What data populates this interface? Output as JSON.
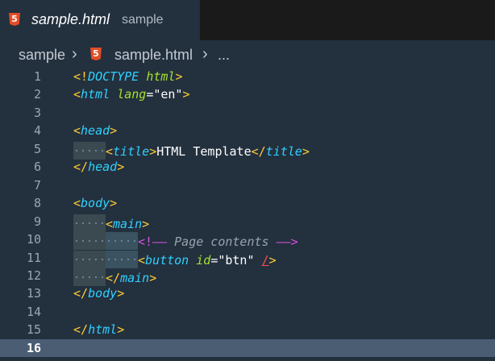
{
  "tab": {
    "title": "sample.html",
    "description": "sample",
    "icon": "html5-icon"
  },
  "breadcrumb": {
    "root": "sample",
    "separator": "›",
    "file": "sample.html",
    "more": "..."
  },
  "editor": {
    "current_line": 16,
    "lines": [
      {
        "n": "1",
        "html": "<span class=\"p\">&lt;!</span><span class=\"t\">DOCTYPE</span> <span class=\"a\">html</span><span class=\"p\">&gt;</span>"
      },
      {
        "n": "2",
        "html": "<span class=\"p\">&lt;</span><span class=\"t\">html</span> <span class=\"a\">lang</span><span class=\"e\">=</span><span class=\"s\">\"en\"</span><span class=\"p\">&gt;</span>"
      },
      {
        "n": "3",
        "html": ""
      },
      {
        "n": "4",
        "html": "<span class=\"p\">&lt;</span><span class=\"t\">head</span><span class=\"p\">&gt;</span>"
      },
      {
        "n": "5",
        "html": "<span class=\"ind tint\"></span><span class=\"p\">&lt;</span><span class=\"t\">title</span><span class=\"p\">&gt;</span><span class=\"s\">HTML Template</span><span class=\"p\">&lt;/</span><span class=\"t\">title</span><span class=\"p\">&gt;</span>"
      },
      {
        "n": "6",
        "html": "<span class=\"p\">&lt;/</span><span class=\"t\">head</span><span class=\"p\">&gt;</span>"
      },
      {
        "n": "7",
        "html": ""
      },
      {
        "n": "8",
        "html": "<span class=\"p\">&lt;</span><span class=\"t\">body</span><span class=\"p\">&gt;</span>"
      },
      {
        "n": "9",
        "html": "<span class=\"ind tint\"></span><span class=\"p\">&lt;</span><span class=\"t\">main</span><span class=\"p\">&gt;</span>"
      },
      {
        "n": "10",
        "html": "<span class=\"ind tint\"></span><span class=\"ind tint2\"></span><span class=\"cm\">&lt;!—— </span><span class=\"c\">Page contents</span><span class=\"cm\"> ——&gt;</span>"
      },
      {
        "n": "11",
        "html": "<span class=\"ind tint\"></span><span class=\"ind tint2\"></span><span class=\"p\">&lt;</span><span class=\"t\">button</span> <span class=\"a\">id</span><span class=\"e\">=</span><span class=\"s\">\"btn\"</span> <span class=\"sl\"><u>/</u>&gt;</span>"
      },
      {
        "n": "12",
        "html": "<span class=\"ind tint\"></span><span class=\"p\">&lt;/</span><span class=\"t\">main</span><span class=\"p\">&gt;</span>"
      },
      {
        "n": "13",
        "html": "<span class=\"p\">&lt;/</span><span class=\"t\">body</span><span class=\"p\">&gt;</span>"
      },
      {
        "n": "14",
        "html": ""
      },
      {
        "n": "15",
        "html": "<span class=\"p\">&lt;/</span><span class=\"t\">html</span><span class=\"p\">&gt;</span>"
      },
      {
        "n": "16",
        "html": ""
      }
    ]
  },
  "colors": {
    "background": "#23303e",
    "tag": "#2fd1ff",
    "bracket": "#ffcc33",
    "attribute": "#a6e22e",
    "comment_delimiter": "#d454e0",
    "html5_icon": "#e44d26",
    "current_line": "#4b5d73"
  }
}
